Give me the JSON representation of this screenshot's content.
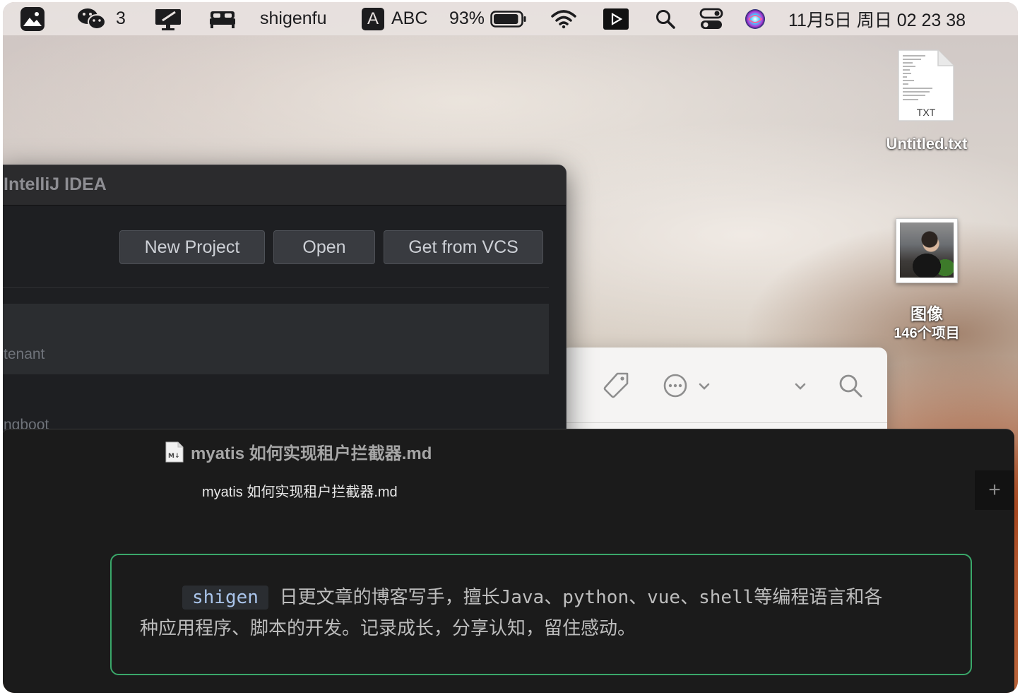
{
  "menubar": {
    "wechat_count": "3",
    "username": "shigenfu",
    "input_letter": "A",
    "input_method": "ABC",
    "battery_percent": "93%",
    "battery_level": 0.93,
    "clock": "11月5日 周日  02 23 38",
    "icons": [
      "photos-icon",
      "wechat-icon",
      "screen-mirror-icon",
      "bed-icon",
      "input-method-icon",
      "battery-icon",
      "wifi-icon",
      "media-player-icon",
      "spotlight-search-icon",
      "control-center-icon",
      "siri-icon"
    ]
  },
  "desktop": {
    "txt_file": {
      "badge": "TXT",
      "name": "Untitled.txt"
    },
    "image_folder": {
      "name": "图像",
      "count": "146个项目"
    }
  },
  "idea": {
    "title": "IntelliJ IDEA",
    "buttons": {
      "new_project": "New Project",
      "open": "Open",
      "get_from_vcs": "Get from VCS"
    },
    "projects": [
      "tenant",
      "ngboot"
    ]
  },
  "finder": {
    "icons": [
      "tag-icon",
      "more-actions-icon",
      "chevron-down-icon",
      "chevron-down-icon",
      "search-icon"
    ]
  },
  "md_window": {
    "title": "myatis 如何实现租户拦截器.md",
    "tab_label": "myatis 如何实现租户拦截器.md",
    "plus": "+",
    "intro": {
      "code": "shigen",
      "line1": " 日更文章的博客写手，擅长Java、python、vue、shell等编程语言和各",
      "line2": "种应用程序、脚本的开发。记录成长，分享认知，留住感动。"
    }
  }
}
